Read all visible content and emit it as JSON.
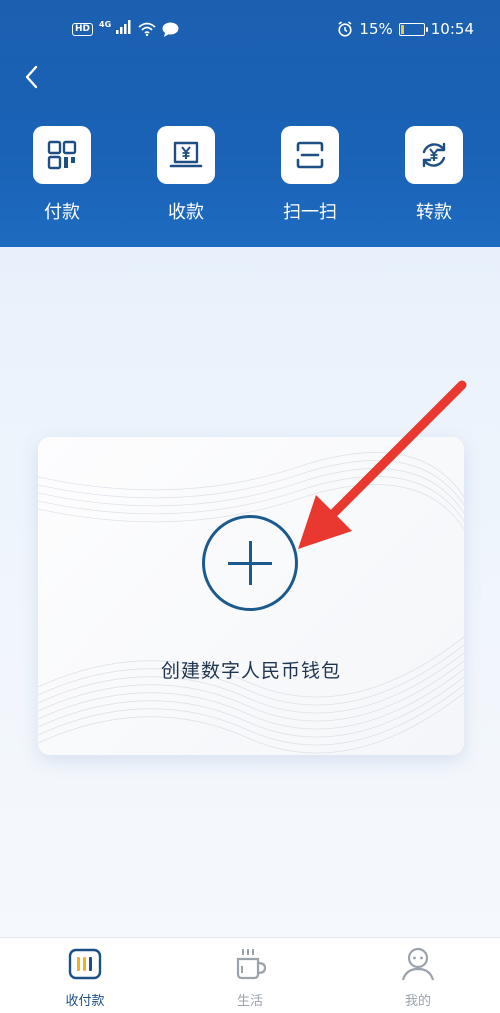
{
  "status_bar": {
    "hd": "HD",
    "network": "4G",
    "battery": "15%",
    "time": "10:54",
    "battery_level": 0.15
  },
  "actions": [
    {
      "label": "付款",
      "icon": "qr-code-icon"
    },
    {
      "label": "收款",
      "icon": "receive-yuan-icon"
    },
    {
      "label": "扫一扫",
      "icon": "scan-icon"
    },
    {
      "label": "转款",
      "icon": "transfer-yuan-icon"
    }
  ],
  "wallet": {
    "create_label": "创建数字人民币钱包"
  },
  "bottom_nav": [
    {
      "label": "收付款",
      "icon": "wallet-icon",
      "active": true
    },
    {
      "label": "生活",
      "icon": "cup-icon",
      "active": false
    },
    {
      "label": "我的",
      "icon": "profile-icon",
      "active": false
    }
  ],
  "colors": {
    "header": "#1b5fb0",
    "accent": "#1c5a8e",
    "arrow": "#e8382f",
    "nav_active": "#1b4f86",
    "nav_inactive": "#9ba3ad"
  }
}
